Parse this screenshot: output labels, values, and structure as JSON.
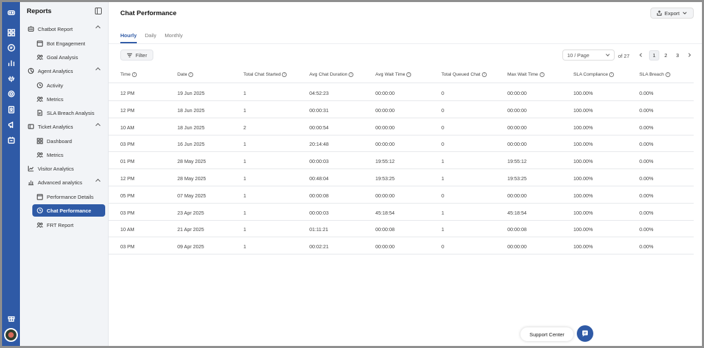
{
  "sidebar": {
    "title": "Reports",
    "items": [
      {
        "label": "Chatbot Report",
        "icon": "bot-icon"
      },
      {
        "label": "Bot Engagement",
        "icon": "calendar-icon"
      },
      {
        "label": "Goal Analysis",
        "icon": "users-icon"
      },
      {
        "label": "Agent Analytics",
        "icon": "pie-chart-icon"
      },
      {
        "label": "Activity",
        "icon": "clock-icon"
      },
      {
        "label": "Metrics",
        "icon": "users-icon"
      },
      {
        "label": "SLA Breach Analysis",
        "icon": "document-icon"
      },
      {
        "label": "Ticket Analytics",
        "icon": "ticket-icon"
      },
      {
        "label": "Dashboard",
        "icon": "grid-icon"
      },
      {
        "label": "Metrics",
        "icon": "users-icon"
      },
      {
        "label": "Visitor Analytics",
        "icon": "line-chart-icon"
      },
      {
        "label": "Advanced analytics",
        "icon": "bar-chart-icon"
      },
      {
        "label": "Performance Details",
        "icon": "calendar-icon"
      },
      {
        "label": "Chat Performance",
        "icon": "clock-icon"
      },
      {
        "label": "FRT Report",
        "icon": "users-icon"
      }
    ]
  },
  "header": {
    "title": "Chat Performance",
    "export_label": "Export"
  },
  "tabs": [
    {
      "label": "Hourly",
      "active": true
    },
    {
      "label": "Daily",
      "active": false
    },
    {
      "label": "Monthly",
      "active": false
    }
  ],
  "toolbar": {
    "filter_label": "Filter",
    "per_page": "10 / Page",
    "of_total": "of 27",
    "pages": [
      "1",
      "2",
      "3"
    ]
  },
  "table": {
    "columns": [
      "Time",
      "Date",
      "Total Chat Started",
      "Avg Chat Duration",
      "Avg Wait Time",
      "Total Queued Chat",
      "Max Wait Time",
      "SLA Compliance",
      "SLA Breach"
    ],
    "rows": [
      [
        "12 PM",
        "19 Jun 2025",
        "1",
        "04:52:23",
        "00:00:00",
        "0",
        "00:00:00",
        "100.00%",
        "0.00%"
      ],
      [
        "12 PM",
        "18 Jun 2025",
        "1",
        "00:00:31",
        "00:00:00",
        "0",
        "00:00:00",
        "100.00%",
        "0.00%"
      ],
      [
        "10 AM",
        "18 Jun 2025",
        "2",
        "00:00:54",
        "00:00:00",
        "0",
        "00:00:00",
        "100.00%",
        "0.00%"
      ],
      [
        "03 PM",
        "16 Jun 2025",
        "1",
        "20:14:48",
        "00:00:00",
        "0",
        "00:00:00",
        "100.00%",
        "0.00%"
      ],
      [
        "01 PM",
        "28 May 2025",
        "1",
        "00:00:03",
        "19:55:12",
        "1",
        "19:55:12",
        "100.00%",
        "0.00%"
      ],
      [
        "12 PM",
        "28 May 2025",
        "1",
        "00:48:04",
        "19:53:25",
        "1",
        "19:53:25",
        "100.00%",
        "0.00%"
      ],
      [
        "05 PM",
        "07 May 2025",
        "1",
        "00:00:08",
        "00:00:00",
        "0",
        "00:00:00",
        "100.00%",
        "0.00%"
      ],
      [
        "03 PM",
        "23 Apr 2025",
        "1",
        "00:00:03",
        "45:18:54",
        "1",
        "45:18:54",
        "100.00%",
        "0.00%"
      ],
      [
        "10 AM",
        "21 Apr 2025",
        "1",
        "01:11:21",
        "00:00:08",
        "1",
        "00:00:08",
        "100.00%",
        "0.00%"
      ],
      [
        "03 PM",
        "09 Apr 2025",
        "1",
        "00:02:21",
        "00:00:00",
        "0",
        "00:00:00",
        "100.00%",
        "0.00%"
      ]
    ]
  },
  "support": {
    "label": "Support Center"
  },
  "colors": {
    "accent": "#2f5aa6",
    "sidebar_bg": "#f2f4f7"
  }
}
